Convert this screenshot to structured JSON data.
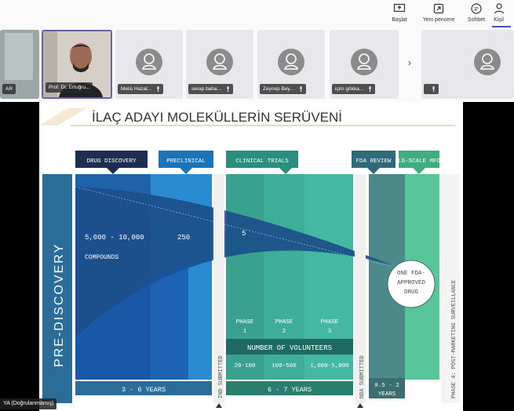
{
  "toolbar": {
    "start_label": "Başlat",
    "new_window_label": "Yeni pencere",
    "chat_label": "Sohbet",
    "people_label": "Kişil"
  },
  "participants": [
    {
      "name": "AR"
    },
    {
      "name": "Prof. Dr. Ertuğru..."
    },
    {
      "name": "Melis Hazal..."
    },
    {
      "name": "serap baha..."
    },
    {
      "name": "Zeynep Bey..."
    },
    {
      "name": "içim gökka..."
    },
    {
      "name": ""
    }
  ],
  "more_label": "›",
  "caption": "YA (Doğrulanmamış)",
  "slide": {
    "title": "İLAÇ ADAYI MOLEKÜLLERİN SERÜVENİ",
    "pre_discovery": "PRE-DISCOVERY",
    "drug_discovery": "DRUG DISCOVERY",
    "preclinical": "PRECLINICAL",
    "clinical_trials": "CLINICAL TRIALS",
    "fda_review": "FDA REVIEW",
    "lg_scale": "LG-SCALE MFG",
    "compounds_count": "5,000 - 10,000",
    "compounds_label": "COMPOUNDS",
    "preclinical_count": "250",
    "clinical_count": "5",
    "approved": [
      "ONE FDA-",
      "APPROVED",
      "DRUG"
    ],
    "phase1": [
      "PHASE",
      "1"
    ],
    "phase2": [
      "PHASE",
      "2"
    ],
    "phase3": [
      "PHASE",
      "3"
    ],
    "volunteers_label": "NUMBER OF VOLUNTEERS",
    "vol1": "20-100",
    "vol2": "100-500",
    "vol3": "1,000-5,000",
    "ind_submitted": "IND SUBMITTED",
    "nda_submitted": "NDA SUBMITTED",
    "phase4": "PHASE 4: POST-MARKETING SURVEILLANCE",
    "years1": "3 - 6 YEARS",
    "years2": "6 - 7 YEARS",
    "years3": [
      "0.5 - 2",
      "YEARS"
    ]
  },
  "colors": {
    "accent": "#6264a7",
    "dark_navy": "#1e2e52",
    "blue_band": "#1c74b8",
    "teal": "#3d9c8e",
    "green": "#4fc79a",
    "slate": "#4c6a7a"
  }
}
